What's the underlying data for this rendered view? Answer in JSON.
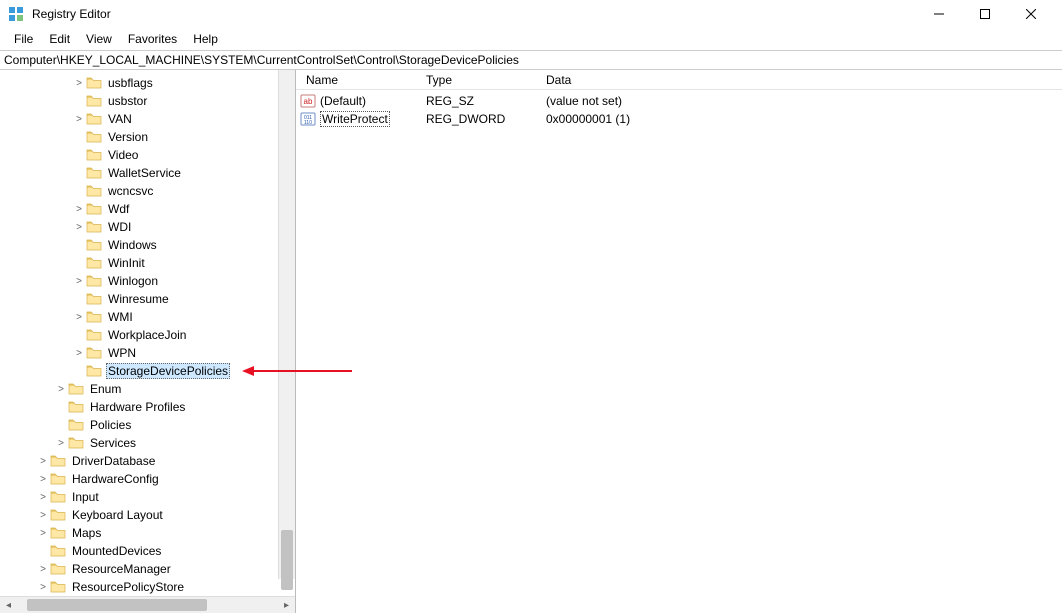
{
  "window": {
    "title": "Registry Editor"
  },
  "menubar": {
    "file": "File",
    "edit": "Edit",
    "view": "View",
    "favorites": "Favorites",
    "help": "Help"
  },
  "address": "Computer\\HKEY_LOCAL_MACHINE\\SYSTEM\\CurrentControlSet\\Control\\StorageDevicePolicies",
  "tree": [
    {
      "label": "usbflags",
      "indent": 4,
      "expander": ">"
    },
    {
      "label": "usbstor",
      "indent": 4,
      "expander": ""
    },
    {
      "label": "VAN",
      "indent": 4,
      "expander": ">"
    },
    {
      "label": "Version",
      "indent": 4,
      "expander": ""
    },
    {
      "label": "Video",
      "indent": 4,
      "expander": ""
    },
    {
      "label": "WalletService",
      "indent": 4,
      "expander": ""
    },
    {
      "label": "wcncsvc",
      "indent": 4,
      "expander": ""
    },
    {
      "label": "Wdf",
      "indent": 4,
      "expander": ">"
    },
    {
      "label": "WDI",
      "indent": 4,
      "expander": ">"
    },
    {
      "label": "Windows",
      "indent": 4,
      "expander": ""
    },
    {
      "label": "WinInit",
      "indent": 4,
      "expander": ""
    },
    {
      "label": "Winlogon",
      "indent": 4,
      "expander": ">"
    },
    {
      "label": "Winresume",
      "indent": 4,
      "expander": ""
    },
    {
      "label": "WMI",
      "indent": 4,
      "expander": ">"
    },
    {
      "label": "WorkplaceJoin",
      "indent": 4,
      "expander": ""
    },
    {
      "label": "WPN",
      "indent": 4,
      "expander": ">"
    },
    {
      "label": "StorageDevicePolicies",
      "indent": 4,
      "expander": "",
      "selected": true
    },
    {
      "label": "Enum",
      "indent": 3,
      "expander": ">"
    },
    {
      "label": "Hardware Profiles",
      "indent": 3,
      "expander": ""
    },
    {
      "label": "Policies",
      "indent": 3,
      "expander": ""
    },
    {
      "label": "Services",
      "indent": 3,
      "expander": ">"
    },
    {
      "label": "DriverDatabase",
      "indent": 2,
      "expander": ">"
    },
    {
      "label": "HardwareConfig",
      "indent": 2,
      "expander": ">"
    },
    {
      "label": "Input",
      "indent": 2,
      "expander": ">"
    },
    {
      "label": "Keyboard Layout",
      "indent": 2,
      "expander": ">"
    },
    {
      "label": "Maps",
      "indent": 2,
      "expander": ">"
    },
    {
      "label": "MountedDevices",
      "indent": 2,
      "expander": ""
    },
    {
      "label": "ResourceManager",
      "indent": 2,
      "expander": ">"
    },
    {
      "label": "ResourcePolicyStore",
      "indent": 2,
      "expander": ">"
    }
  ],
  "list": {
    "headers": {
      "name": "Name",
      "type": "Type",
      "data": "Data"
    },
    "rows": [
      {
        "icon": "string",
        "name": "(Default)",
        "type": "REG_SZ",
        "data": "(value not set)",
        "selected": false
      },
      {
        "icon": "dword",
        "name": "WriteProtect",
        "type": "REG_DWORD",
        "data": "0x00000001 (1)",
        "selected": true
      }
    ]
  }
}
